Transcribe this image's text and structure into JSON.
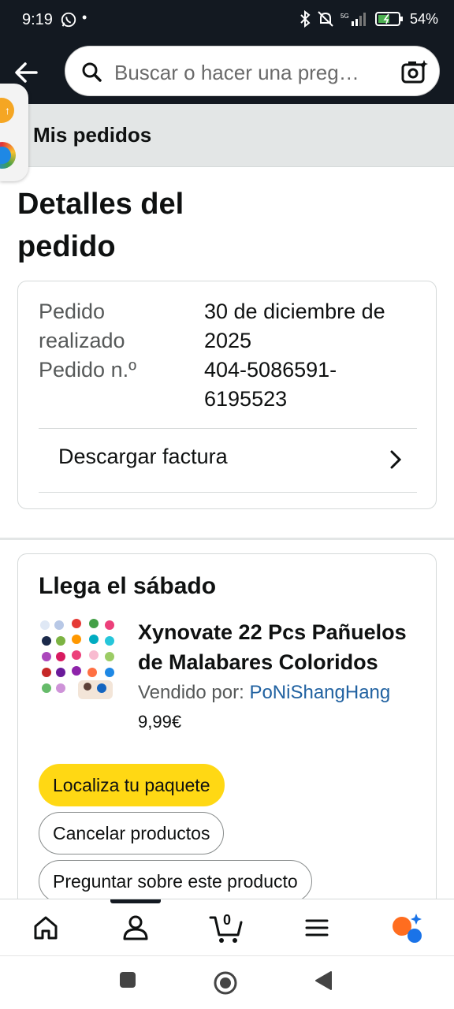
{
  "status": {
    "time": "9:19",
    "battery": "54%"
  },
  "search": {
    "placeholder": "Buscar o hacer una preg…"
  },
  "breadcrumb": {
    "label": "Mis pedidos"
  },
  "page": {
    "title": "Detalles del pedido"
  },
  "order": {
    "placed_label": "Pedido realizado",
    "placed_value": "30 de diciembre de 2025",
    "number_label": "Pedido n.º",
    "number_value": "404-5086591-6195523",
    "invoice_label": "Descargar factura"
  },
  "shipment": {
    "arrival": "Llega el sábado",
    "product_name": "Xynovate 22 Pcs Pañuelos de Malabares Coloridos",
    "seller_prefix": "Vendido por:",
    "seller_name": "PoNiShangHang",
    "price": "9,99€",
    "buttons": {
      "track": "Localiza tu paquete",
      "cancel": "Cancelar productos",
      "ask": "Preguntar sobre este producto"
    }
  },
  "nav": {
    "cart_count": "0"
  },
  "colors": {
    "header_bg": "#131921",
    "primary_button": "#ffd814",
    "link": "#2162a1",
    "breadcrumb_bg": "#e3e6e6"
  },
  "icons": [
    "back-arrow-icon",
    "search-icon",
    "camera-icon",
    "chevron-right-icon",
    "home-icon",
    "account-icon",
    "cart-icon",
    "menu-icon",
    "rufus-icon"
  ]
}
